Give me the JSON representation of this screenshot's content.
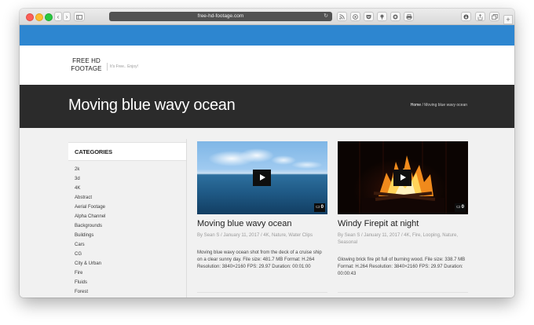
{
  "browser": {
    "url": "free-hd-footage.com",
    "back_glyph": "‹",
    "forward_glyph": "›",
    "reload_glyph": "↻",
    "icons": [
      "sidebar-icon",
      "rss-icon",
      "at-icon",
      "pocket-icon",
      "pin-icon",
      "globe-icon",
      "print-icon",
      "download-icon",
      "share-icon",
      "tabs-icon",
      "new-tab-icon"
    ]
  },
  "site": {
    "logo_line1": "FREE HD",
    "logo_line2": "FOOTAGE",
    "tagline": "It's Free.. Enjoy!",
    "accent_color": "#2d86d0"
  },
  "banner": {
    "title": "Moving blue wavy ocean",
    "breadcrumb_home": "Home",
    "breadcrumb_current": " / Moving blue wavy ocean"
  },
  "sidebar": {
    "heading": "CATEGORIES",
    "items": [
      "2k",
      "3d",
      "4K",
      "Abstract",
      "Aerial Footage",
      "Alpha Channel",
      "Backgrounds",
      "Buildings",
      "Cars",
      "CG",
      "City & Urban",
      "Fire",
      "Fluids",
      "Forest"
    ]
  },
  "cards": [
    {
      "title": "Moving blue wavy ocean",
      "meta": "By Sean S / January 11, 2017 / 4K, Nature, Water Clips",
      "description": "Moving blue wavy ocean shot from the deck of a cruise ship on a clear sunny day. File size: 481.7 MB Format: H.264 Resolution: 3840×2160 FPS: 29.97 Duration: 00:01:00",
      "comments": "0"
    },
    {
      "title": "Windy Firepit at night",
      "meta": "By Sean S / January 11, 2017 / 4K, Fire, Looping, Nature, Seasonal",
      "description": "Glowing brick fire pit full of burning wood. File size: 338.7 MB Format: H.264 Resolution: 3840×2160 FPS: 29.97 Duration: 00:00:43",
      "comments": "0"
    }
  ]
}
